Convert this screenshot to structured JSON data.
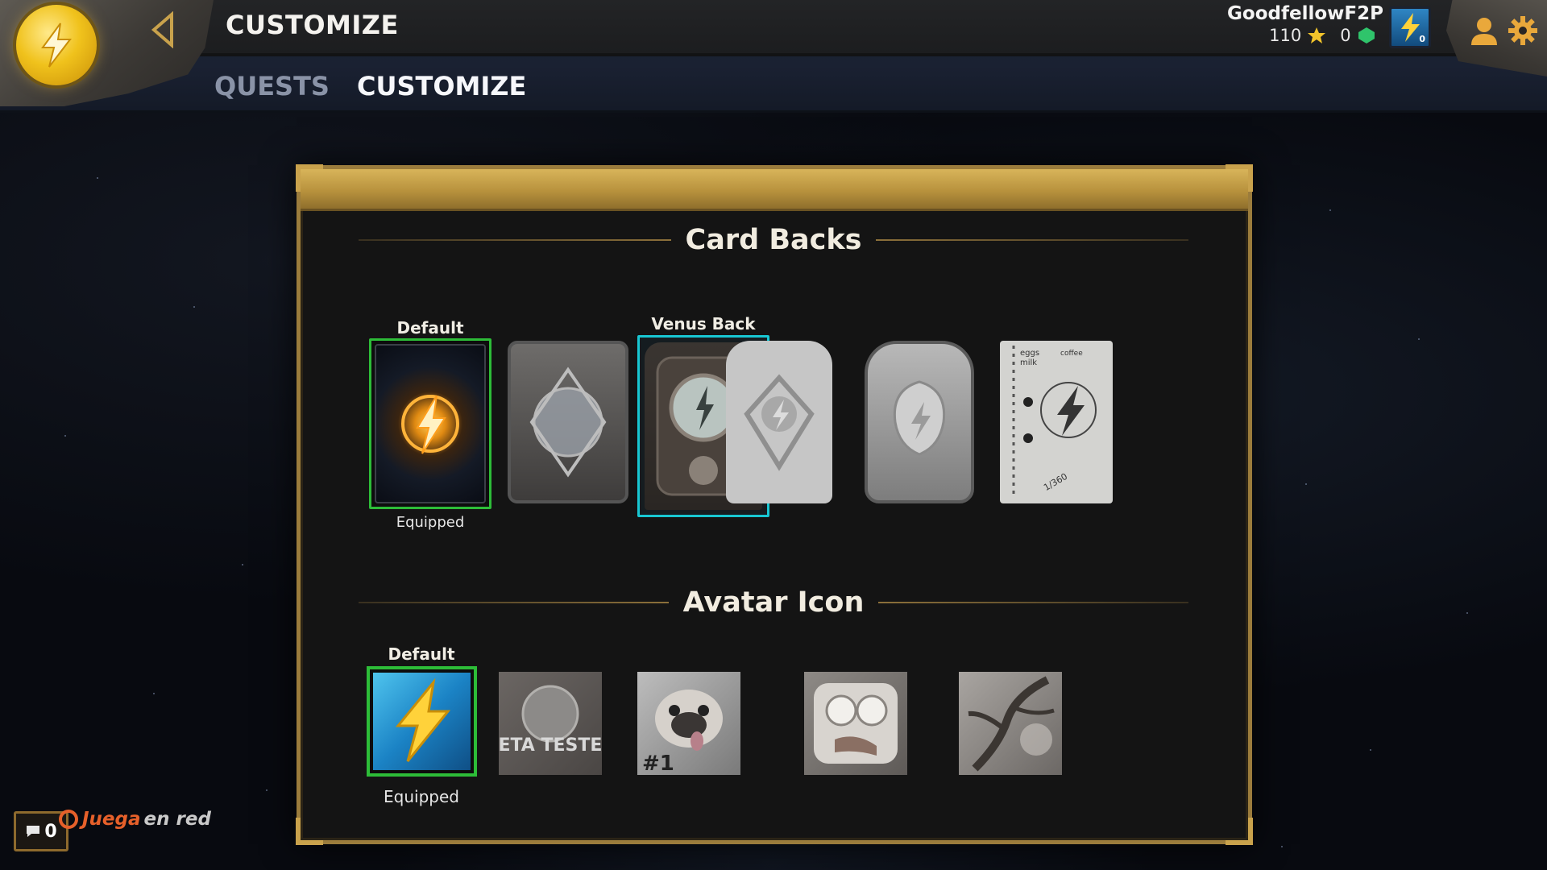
{
  "header": {
    "title": "CUSTOMIZE",
    "tabs": [
      {
        "label": "QUESTS",
        "active": false
      },
      {
        "label": "CUSTOMIZE",
        "active": true
      }
    ]
  },
  "user": {
    "name": "GoodfellowF2P",
    "currencies": [
      {
        "value": "110",
        "icon": "gold-star-icon"
      },
      {
        "value": "0",
        "icon": "green-gem-icon"
      },
      {
        "value": "0",
        "icon": "blue-orb-icon"
      }
    ],
    "level_badge": "0"
  },
  "card_backs": {
    "title": "Card Backs",
    "items": [
      {
        "label": "Default",
        "status": "Equipped",
        "locked": false
      },
      {
        "label": "",
        "locked": true
      },
      {
        "label": "Venus Back",
        "selected": true,
        "locked": false
      },
      {
        "label": "",
        "locked": true
      },
      {
        "label": "",
        "locked": true
      },
      {
        "label": "",
        "locked": true,
        "notes": [
          "eggs",
          "milk",
          "coffee",
          "1/360"
        ]
      }
    ]
  },
  "avatar_icons": {
    "title": "Avatar Icon",
    "items": [
      {
        "label": "Default",
        "status": "Equipped",
        "locked": false
      },
      {
        "label": "",
        "locked": true,
        "text": "BETA TESTER"
      },
      {
        "label": "",
        "locked": true,
        "text": "#1"
      },
      {
        "label": "",
        "locked": true
      },
      {
        "label": "",
        "locked": true
      }
    ]
  },
  "chat": {
    "count": "0"
  },
  "branding": {
    "juega": "Juega",
    "en_red": "en red"
  },
  "colors": {
    "accent_gold": "#c9a24c",
    "equipped_green": "#2dbd38",
    "selected_cyan": "#18c7d3"
  }
}
